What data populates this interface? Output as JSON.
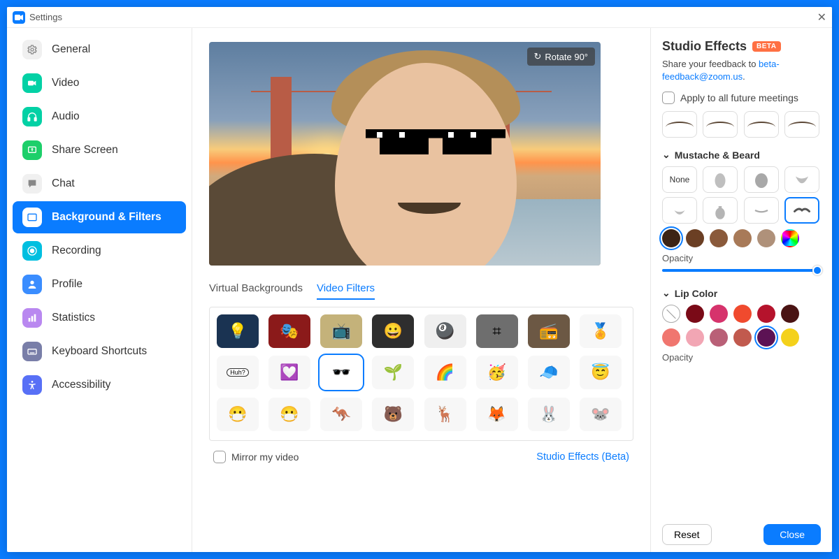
{
  "window": {
    "title": "Settings"
  },
  "sidebar": {
    "items": [
      {
        "label": "General",
        "icon": "gear",
        "color": "#f0f0f0",
        "fg": "#888"
      },
      {
        "label": "Video",
        "icon": "camera",
        "color": "#03d1a5",
        "fg": "#fff"
      },
      {
        "label": "Audio",
        "icon": "headphones",
        "color": "#03d1a5",
        "fg": "#fff"
      },
      {
        "label": "Share Screen",
        "icon": "share",
        "color": "#1dcf6a",
        "fg": "#fff"
      },
      {
        "label": "Chat",
        "icon": "chat",
        "color": "#f0f0f0",
        "fg": "#888"
      },
      {
        "label": "Background & Filters",
        "icon": "bgfilter",
        "color": "#ffffff",
        "fg": "#0a7cff"
      },
      {
        "label": "Recording",
        "icon": "record",
        "color": "#00bfe0",
        "fg": "#fff"
      },
      {
        "label": "Profile",
        "icon": "profile",
        "color": "#3a8dff",
        "fg": "#fff"
      },
      {
        "label": "Statistics",
        "icon": "stats",
        "color": "#b988f0",
        "fg": "#fff"
      },
      {
        "label": "Keyboard Shortcuts",
        "icon": "keyboard",
        "color": "#797ea8",
        "fg": "#fff"
      },
      {
        "label": "Accessibility",
        "icon": "accessibility",
        "color": "#5870f6",
        "fg": "#fff"
      }
    ],
    "active_index": 5
  },
  "center": {
    "rotate_label": "Rotate 90°",
    "tabs": [
      {
        "label": "Virtual Backgrounds",
        "active": false
      },
      {
        "label": "Video Filters",
        "active": true
      }
    ],
    "filters": [
      {
        "name": "string-lights",
        "emoji": "💡",
        "bg": "#1a3352"
      },
      {
        "name": "theater",
        "emoji": "🎭",
        "bg": "#8b1a1a"
      },
      {
        "name": "tv",
        "emoji": "📺",
        "bg": "#c4b27a"
      },
      {
        "name": "emoji-frame",
        "emoji": "😀",
        "bg": "#2e2e2e"
      },
      {
        "name": "pool-balls",
        "emoji": "🎱",
        "bg": "#efefef"
      },
      {
        "name": "crop",
        "emoji": "⌗",
        "bg": "#6e6e6e"
      },
      {
        "name": "retro-tv",
        "emoji": "📻",
        "bg": "#6c5844"
      },
      {
        "name": "award",
        "emoji": "🏅",
        "bg": "#f7f7f7"
      },
      {
        "name": "huh-bubble",
        "emoji": "💬",
        "bg": "#f7f7f7",
        "text": "Huh?"
      },
      {
        "name": "heart",
        "emoji": "💟",
        "bg": "#f7f7f7"
      },
      {
        "name": "deal-glasses",
        "emoji": "🕶️",
        "bg": "#ffffff",
        "selected": true
      },
      {
        "name": "sprout",
        "emoji": "🌱",
        "bg": "#f7f7f7"
      },
      {
        "name": "rainbow",
        "emoji": "🌈",
        "bg": "#f7f7f7"
      },
      {
        "name": "party",
        "emoji": "🥳",
        "bg": "#f7f7f7"
      },
      {
        "name": "cap",
        "emoji": "🧢",
        "bg": "#f7f7f7"
      },
      {
        "name": "halo",
        "emoji": "😇",
        "bg": "#f7f7f7"
      },
      {
        "name": "n95-mask",
        "emoji": "😷",
        "bg": "#f7f7f7"
      },
      {
        "name": "medical-mask",
        "emoji": "😷",
        "bg": "#f7f7f7"
      },
      {
        "name": "kangaroo",
        "emoji": "🦘",
        "bg": "#f7f7f7"
      },
      {
        "name": "bear",
        "emoji": "🐻",
        "bg": "#f7f7f7"
      },
      {
        "name": "reindeer",
        "emoji": "🦌",
        "bg": "#f7f7f7"
      },
      {
        "name": "fox",
        "emoji": "🦊",
        "bg": "#f7f7f7"
      },
      {
        "name": "bunny",
        "emoji": "🐰",
        "bg": "#f7f7f7"
      },
      {
        "name": "mouse",
        "emoji": "🐭",
        "bg": "#f7f7f7"
      }
    ],
    "mirror_label": "Mirror my video",
    "studio_link": "Studio Effects (Beta)"
  },
  "rpanel": {
    "title": "Studio Effects",
    "beta": "BETA",
    "feedback_text": "Share your feedback to ",
    "feedback_email": "beta-feedback@zoom.us",
    "apply_all": "Apply to all future meetings",
    "sections": {
      "eyebrows": {
        "options": 4
      },
      "mustache": {
        "title": "Mustache & Beard",
        "options": [
          "None",
          "goatee-1",
          "goatee-2",
          "chin-strap",
          "soul-patch",
          "van-dyke",
          "thin",
          "handlebar"
        ],
        "selected_index": 7
      },
      "mustache_colors": [
        "#3c2415",
        "#6b3f24",
        "#8a5a3b",
        "#a87a58",
        "#af917a",
        "rainbow"
      ],
      "mustache_color_selected": 0,
      "opacity_label": "Opacity",
      "lip": {
        "title": "Lip Color",
        "colors": [
          "none",
          "#7a0a17",
          "#d6336c",
          "#f04a2e",
          "#b5132c",
          "#4a1313",
          "#f0766f",
          "#f2a6b4",
          "#b96077",
          "#c15a4e",
          "#5c1254",
          "#f4d11b"
        ],
        "selected_index": 10
      }
    },
    "reset": "Reset",
    "close": "Close"
  }
}
